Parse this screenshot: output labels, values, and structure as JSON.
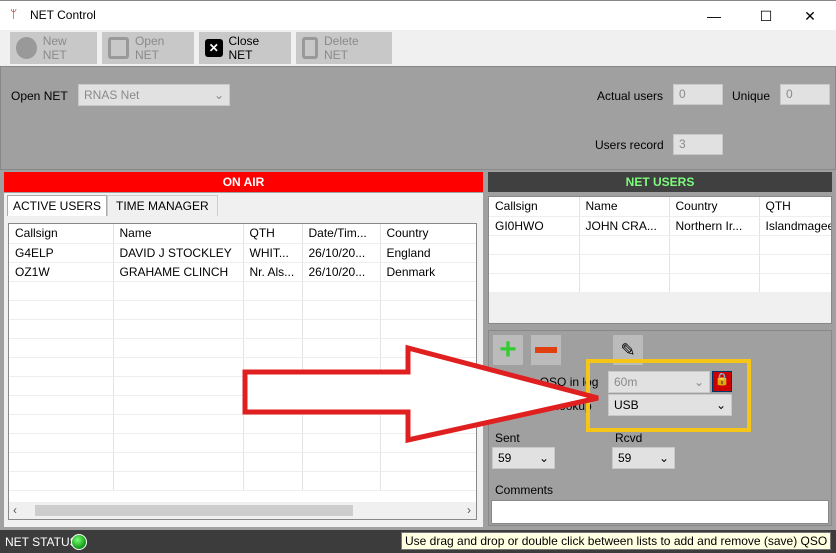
{
  "window": {
    "title": "NET Control",
    "minimize": "—",
    "maximize": "☐",
    "close": "✕"
  },
  "toolbar": {
    "new_net": "New NET",
    "open_net": "Open NET",
    "close_net": "Close NET",
    "delete_net": "Delete NET"
  },
  "settings": {
    "open_net_label": "Open NET",
    "open_net_value": "RNAS Net",
    "actual_users_label": "Actual users",
    "actual_users": "0",
    "unique_label": "Unique",
    "unique": "0",
    "users_record_label": "Users record",
    "users_record": "3"
  },
  "on_air": {
    "header": "ON AIR",
    "tabs": [
      "ACTIVE USERS",
      "TIME MANAGER"
    ],
    "columns": [
      "Callsign",
      "Name",
      "QTH",
      "Date/Tim...",
      "Country"
    ],
    "rows": [
      [
        "G4ELP",
        "DAVID J STOCKLEY",
        "WHIT...",
        "26/10/20...",
        "England"
      ],
      [
        "OZ1W",
        "GRAHAME CLINCH",
        "Nr. Als...",
        "26/10/20...",
        "Denmark"
      ]
    ]
  },
  "net_users": {
    "header": "NET USERS",
    "columns": [
      "Callsign",
      "Name",
      "Country",
      "QTH"
    ],
    "rows": [
      [
        "GI0HWO",
        "JOHN CRA...",
        "Northern Ir...",
        "Islandmagee"
      ]
    ]
  },
  "qso": {
    "save_label": "Save QSO in log",
    "lookup_label": "External lookup",
    "band": "60m",
    "mode": "USB",
    "sent_label": "Sent",
    "sent": "59",
    "rcvd_label": "Rcvd",
    "rcvd": "59",
    "comments_label": "Comments",
    "comments": ""
  },
  "status": {
    "label": "NET STATUS",
    "tooltip": "Use drag and drop or double click between lists to add and remove (save) QSO"
  },
  "colors": {
    "on_air": "#ff0000",
    "net_users_header": "#404040",
    "net_users_text": "#7cfc7c",
    "highlight": "#f5c518",
    "arrow": "#e02020",
    "status_led": "#1fa51f"
  }
}
